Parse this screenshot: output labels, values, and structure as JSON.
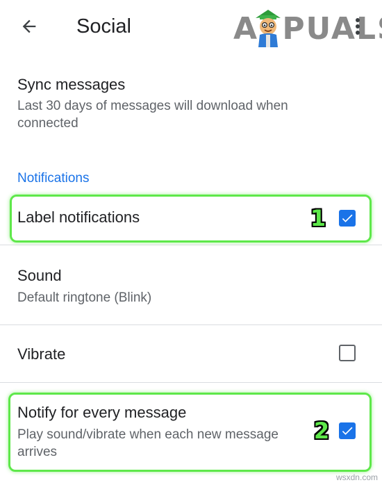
{
  "appbar": {
    "title": "Social",
    "back_icon": "arrow-back-icon",
    "overflow_icon": "more-vert-icon"
  },
  "logo": {
    "text": "APPUALS"
  },
  "sync": {
    "title": "Sync messages",
    "summary": "Last 30 days of messages will download when connected"
  },
  "notifications": {
    "header": "Notifications",
    "label_notifications": {
      "title": "Label notifications",
      "checked": true
    },
    "sound": {
      "title": "Sound",
      "summary": "Default ringtone (Blink)"
    },
    "vibrate": {
      "title": "Vibrate",
      "checked": false
    },
    "notify_every": {
      "title": "Notify for every message",
      "summary": "Play sound/vibrate when each new message arrives",
      "checked": true
    }
  },
  "annotations": {
    "marker_1": "1",
    "marker_2": "2",
    "highlight_color": "#5ee84a"
  },
  "colors": {
    "accent": "#1a73e8",
    "text_primary": "#202124",
    "text_secondary": "#5f6368"
  },
  "footer": {
    "watermark": "wsxdn.com"
  }
}
